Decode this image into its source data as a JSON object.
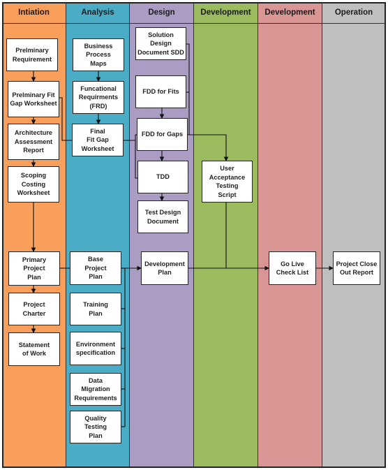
{
  "lanes": [
    {
      "id": "initiation",
      "title": "Intiation",
      "color": "#F79F5B"
    },
    {
      "id": "analysis",
      "title": "Analysis",
      "color": "#4BACC6"
    },
    {
      "id": "design",
      "title": "Design",
      "color": "#AB9CC4"
    },
    {
      "id": "development1",
      "title": "Development",
      "color": "#9BBB5F"
    },
    {
      "id": "development2",
      "title": "Development",
      "color": "#D99694"
    },
    {
      "id": "operation",
      "title": "Operation",
      "color": "#BFBFBF"
    }
  ],
  "boxes": [
    {
      "id": "prelim-req",
      "lane": "initiation",
      "label": "Prelminary\nRequirement"
    },
    {
      "id": "prelim-fitgap",
      "lane": "initiation",
      "label": "Prelminary Fit\nGap Worksheet"
    },
    {
      "id": "arch-report",
      "lane": "initiation",
      "label": "Architecture\nAssessment\nReport"
    },
    {
      "id": "scoping",
      "lane": "initiation",
      "label": "Scoping\nCosting\nWorksheet"
    },
    {
      "id": "primary-plan",
      "lane": "initiation",
      "label": "Primary\nProject\nPlan"
    },
    {
      "id": "charter",
      "lane": "initiation",
      "label": "Project\nCharter"
    },
    {
      "id": "sow",
      "lane": "initiation",
      "label": "Statement\nof Work"
    },
    {
      "id": "bpm",
      "lane": "analysis",
      "label": "Business\nProcess\nMaps"
    },
    {
      "id": "frd",
      "lane": "analysis",
      "label": "Funcational\nRequirments\n(FRD)"
    },
    {
      "id": "final-fitgap",
      "lane": "analysis",
      "label": "Final\nFit Gap\nWorksheet"
    },
    {
      "id": "base-plan",
      "lane": "analysis",
      "label": "Base\nProject\nPlan"
    },
    {
      "id": "training",
      "lane": "analysis",
      "label": "Training\nPlan"
    },
    {
      "id": "env-spec",
      "lane": "analysis",
      "label": "Environment\nspecification"
    },
    {
      "id": "data-mig",
      "lane": "analysis",
      "label": "Data\nMigration\nRequirements"
    },
    {
      "id": "qtp",
      "lane": "analysis",
      "label": "Quality\nTesting\nPlan"
    },
    {
      "id": "sdd",
      "lane": "design",
      "label": "Solution\nDesign\nDocument  SDD"
    },
    {
      "id": "fdd-fits",
      "lane": "design",
      "label": "FDD for Fits"
    },
    {
      "id": "fdd-gaps",
      "lane": "design",
      "label": "FDD for Gaps"
    },
    {
      "id": "tdd",
      "lane": "design",
      "label": "TDD"
    },
    {
      "id": "test-design",
      "lane": "design",
      "label": "Test Design\nDocument"
    },
    {
      "id": "dev-plan",
      "lane": "design",
      "label": "Development\nPlan"
    },
    {
      "id": "uat",
      "lane": "development1",
      "label": "User\nAcceptance\nTesting\nScript"
    },
    {
      "id": "go-live",
      "lane": "development2",
      "label": "Go Live\nCheck List"
    },
    {
      "id": "close-out",
      "lane": "operation",
      "label": "Project Close\nOut Report"
    }
  ]
}
